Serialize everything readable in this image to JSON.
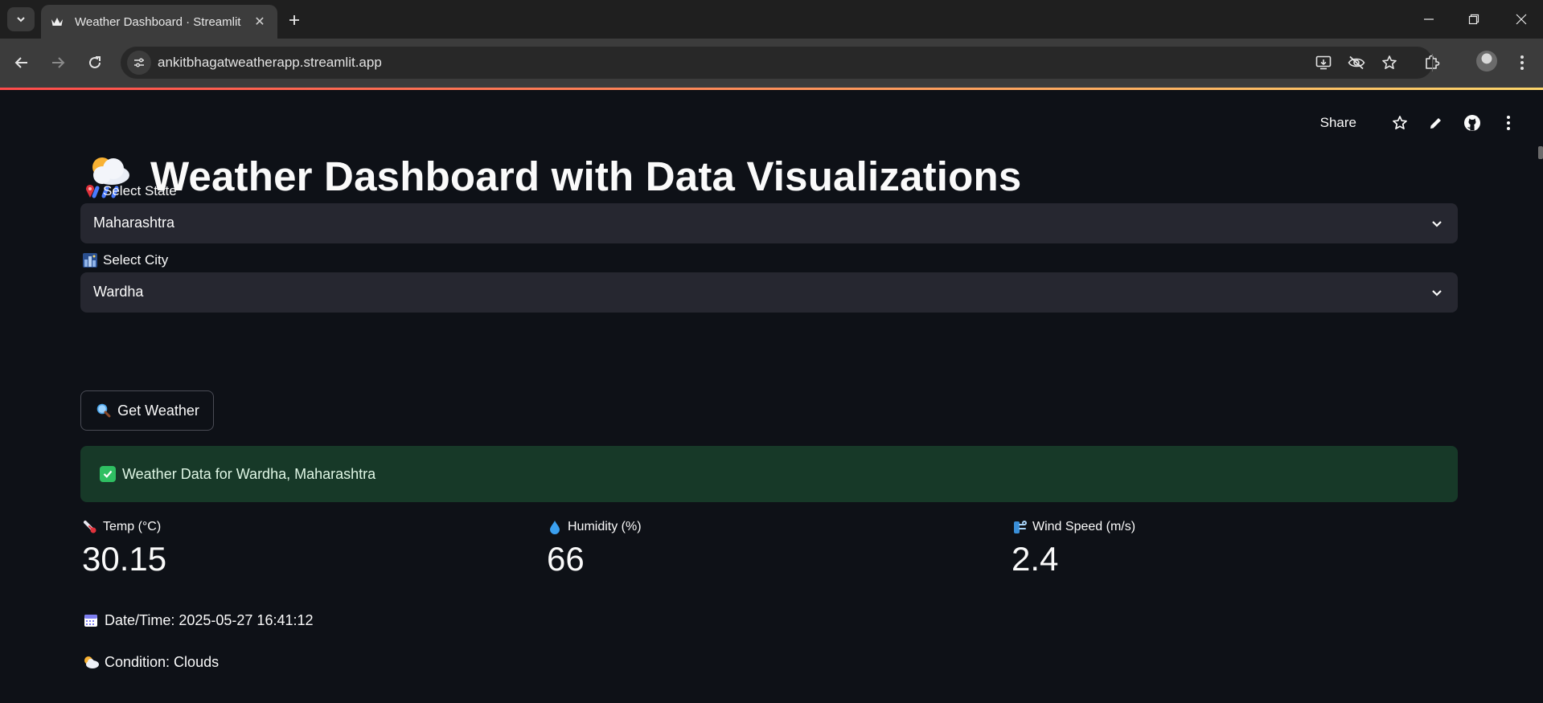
{
  "browser": {
    "tab_title": "Weather Dashboard · Streamlit",
    "url": "ankitbhagatweatherapp.streamlit.app"
  },
  "app_header": {
    "share_label": "Share"
  },
  "page": {
    "title": "Weather Dashboard with Data Visualizations"
  },
  "state_select": {
    "label": "Select State",
    "value": "Maharashtra"
  },
  "city_select": {
    "label": "Select City",
    "value": "Wardha"
  },
  "get_weather_button": {
    "label": "Get Weather"
  },
  "success_message": "Weather Data for Wardha, Maharashtra",
  "metrics": [
    {
      "label": "Temp (°C)",
      "value": "30.15",
      "icon": "thermometer-icon"
    },
    {
      "label": "Humidity (%)",
      "value": "66",
      "icon": "droplet-icon"
    },
    {
      "label": "Wind Speed (m/s)",
      "value": "2.4",
      "icon": "wind-icon"
    }
  ],
  "datetime_line": "Date/Time: 2025-05-27 16:41:12",
  "condition_line": "Condition: Clouds",
  "colors": {
    "app_background": "#0e1117",
    "select_background": "#262730",
    "success_background": "#173928",
    "accent_gradient_start": "#ff4b4b",
    "accent_gradient_end": "#fdd66b"
  }
}
